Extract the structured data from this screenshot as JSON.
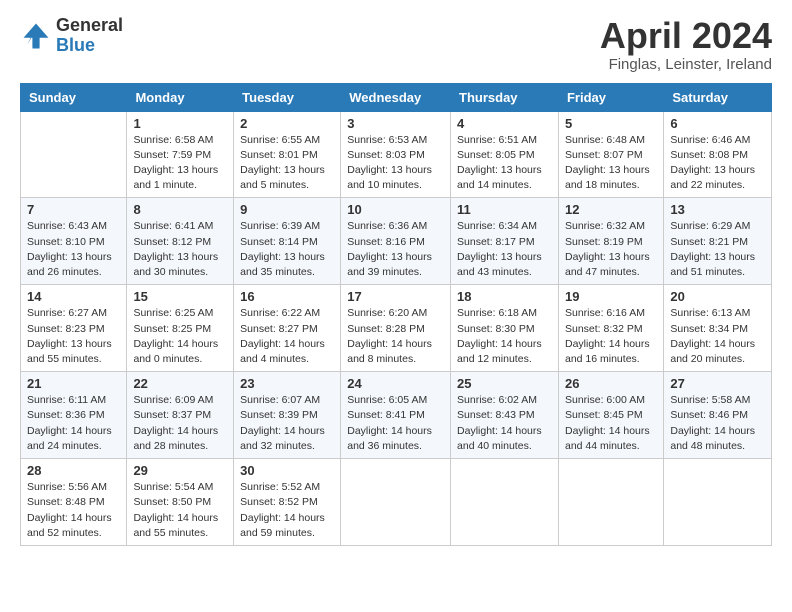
{
  "logo": {
    "general": "General",
    "blue": "Blue"
  },
  "header": {
    "month_year": "April 2024",
    "location": "Finglas, Leinster, Ireland"
  },
  "weekdays": [
    "Sunday",
    "Monday",
    "Tuesday",
    "Wednesday",
    "Thursday",
    "Friday",
    "Saturday"
  ],
  "weeks": [
    [
      {
        "day": "",
        "info": ""
      },
      {
        "day": "1",
        "info": "Sunrise: 6:58 AM\nSunset: 7:59 PM\nDaylight: 13 hours\nand 1 minute."
      },
      {
        "day": "2",
        "info": "Sunrise: 6:55 AM\nSunset: 8:01 PM\nDaylight: 13 hours\nand 5 minutes."
      },
      {
        "day": "3",
        "info": "Sunrise: 6:53 AM\nSunset: 8:03 PM\nDaylight: 13 hours\nand 10 minutes."
      },
      {
        "day": "4",
        "info": "Sunrise: 6:51 AM\nSunset: 8:05 PM\nDaylight: 13 hours\nand 14 minutes."
      },
      {
        "day": "5",
        "info": "Sunrise: 6:48 AM\nSunset: 8:07 PM\nDaylight: 13 hours\nand 18 minutes."
      },
      {
        "day": "6",
        "info": "Sunrise: 6:46 AM\nSunset: 8:08 PM\nDaylight: 13 hours\nand 22 minutes."
      }
    ],
    [
      {
        "day": "7",
        "info": "Sunrise: 6:43 AM\nSunset: 8:10 PM\nDaylight: 13 hours\nand 26 minutes."
      },
      {
        "day": "8",
        "info": "Sunrise: 6:41 AM\nSunset: 8:12 PM\nDaylight: 13 hours\nand 30 minutes."
      },
      {
        "day": "9",
        "info": "Sunrise: 6:39 AM\nSunset: 8:14 PM\nDaylight: 13 hours\nand 35 minutes."
      },
      {
        "day": "10",
        "info": "Sunrise: 6:36 AM\nSunset: 8:16 PM\nDaylight: 13 hours\nand 39 minutes."
      },
      {
        "day": "11",
        "info": "Sunrise: 6:34 AM\nSunset: 8:17 PM\nDaylight: 13 hours\nand 43 minutes."
      },
      {
        "day": "12",
        "info": "Sunrise: 6:32 AM\nSunset: 8:19 PM\nDaylight: 13 hours\nand 47 minutes."
      },
      {
        "day": "13",
        "info": "Sunrise: 6:29 AM\nSunset: 8:21 PM\nDaylight: 13 hours\nand 51 minutes."
      }
    ],
    [
      {
        "day": "14",
        "info": "Sunrise: 6:27 AM\nSunset: 8:23 PM\nDaylight: 13 hours\nand 55 minutes."
      },
      {
        "day": "15",
        "info": "Sunrise: 6:25 AM\nSunset: 8:25 PM\nDaylight: 14 hours\nand 0 minutes."
      },
      {
        "day": "16",
        "info": "Sunrise: 6:22 AM\nSunset: 8:27 PM\nDaylight: 14 hours\nand 4 minutes."
      },
      {
        "day": "17",
        "info": "Sunrise: 6:20 AM\nSunset: 8:28 PM\nDaylight: 14 hours\nand 8 minutes."
      },
      {
        "day": "18",
        "info": "Sunrise: 6:18 AM\nSunset: 8:30 PM\nDaylight: 14 hours\nand 12 minutes."
      },
      {
        "day": "19",
        "info": "Sunrise: 6:16 AM\nSunset: 8:32 PM\nDaylight: 14 hours\nand 16 minutes."
      },
      {
        "day": "20",
        "info": "Sunrise: 6:13 AM\nSunset: 8:34 PM\nDaylight: 14 hours\nand 20 minutes."
      }
    ],
    [
      {
        "day": "21",
        "info": "Sunrise: 6:11 AM\nSunset: 8:36 PM\nDaylight: 14 hours\nand 24 minutes."
      },
      {
        "day": "22",
        "info": "Sunrise: 6:09 AM\nSunset: 8:37 PM\nDaylight: 14 hours\nand 28 minutes."
      },
      {
        "day": "23",
        "info": "Sunrise: 6:07 AM\nSunset: 8:39 PM\nDaylight: 14 hours\nand 32 minutes."
      },
      {
        "day": "24",
        "info": "Sunrise: 6:05 AM\nSunset: 8:41 PM\nDaylight: 14 hours\nand 36 minutes."
      },
      {
        "day": "25",
        "info": "Sunrise: 6:02 AM\nSunset: 8:43 PM\nDaylight: 14 hours\nand 40 minutes."
      },
      {
        "day": "26",
        "info": "Sunrise: 6:00 AM\nSunset: 8:45 PM\nDaylight: 14 hours\nand 44 minutes."
      },
      {
        "day": "27",
        "info": "Sunrise: 5:58 AM\nSunset: 8:46 PM\nDaylight: 14 hours\nand 48 minutes."
      }
    ],
    [
      {
        "day": "28",
        "info": "Sunrise: 5:56 AM\nSunset: 8:48 PM\nDaylight: 14 hours\nand 52 minutes."
      },
      {
        "day": "29",
        "info": "Sunrise: 5:54 AM\nSunset: 8:50 PM\nDaylight: 14 hours\nand 55 minutes."
      },
      {
        "day": "30",
        "info": "Sunrise: 5:52 AM\nSunset: 8:52 PM\nDaylight: 14 hours\nand 59 minutes."
      },
      {
        "day": "",
        "info": ""
      },
      {
        "day": "",
        "info": ""
      },
      {
        "day": "",
        "info": ""
      },
      {
        "day": "",
        "info": ""
      }
    ]
  ]
}
